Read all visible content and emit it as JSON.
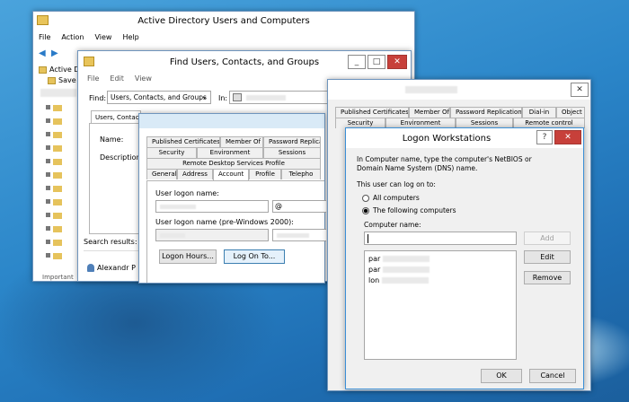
{
  "ad_window": {
    "title": "Active Directory Users and Computers",
    "menu": [
      "File",
      "Action",
      "View",
      "Help"
    ],
    "tree_items": [
      "Active D",
      "Save"
    ],
    "results_label": "Search results:",
    "result_user": "Alexandr P",
    "status_text": "Important"
  },
  "find_window": {
    "title": "Find Users, Contacts, and Groups",
    "menu": [
      "File",
      "Edit",
      "View"
    ],
    "find_label": "Find:",
    "find_value": "Users, Contacts, and Groups",
    "in_label": "In:",
    "tab_label": "Users, Contac",
    "name_label": "Name:",
    "description_label": "Description:"
  },
  "user_props": {
    "tabs_row1": [
      "Published Certificates",
      "Member Of",
      "Password Replication"
    ],
    "tabs_row2": [
      "Security",
      "Environment",
      "Sessions"
    ],
    "tabs_row3": [
      "Remote Desktop Services Profile"
    ],
    "tabs_row4": [
      "General",
      "Address",
      "Account",
      "Profile",
      "Telepho"
    ],
    "logon_name_label": "User logon name:",
    "logon_domain": "@",
    "pre2000_label": "User logon name (pre-Windows 2000):",
    "logon_hours_btn": "Logon Hours...",
    "logon_to_btn": "Log On To..."
  },
  "props_back": {
    "tabs_row1": [
      "Published Certificates",
      "Member Of",
      "Password Replication",
      "Dial-in",
      "Object"
    ],
    "tabs_row2": [
      "Security",
      "Environment",
      "Sessions",
      "Remote control"
    ]
  },
  "logon_ws": {
    "title": "Logon Workstations",
    "help_btn": "?",
    "intro": "In Computer name, type the computer's NetBIOS or Domain Name System (DNS) name.",
    "can_log_on": "This user can log on to:",
    "opt_all": "All computers",
    "opt_following": "The following computers",
    "computer_name_label": "Computer name:",
    "add_btn": "Add",
    "edit_btn": "Edit",
    "remove_btn": "Remove",
    "computers": [
      "par",
      "par",
      "lon"
    ],
    "ok_btn": "OK",
    "cancel_btn": "Cancel"
  }
}
